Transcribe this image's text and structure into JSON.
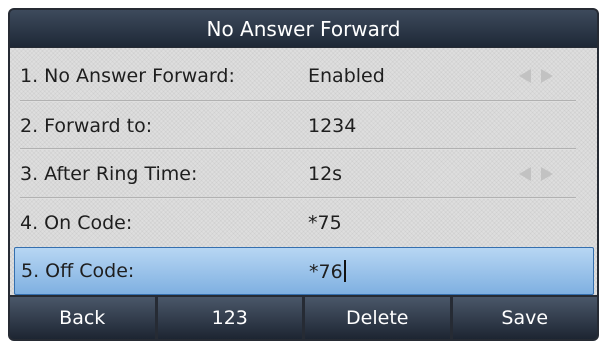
{
  "screen": {
    "title": "No Answer Forward"
  },
  "rows": [
    {
      "label": "1. No Answer Forward:",
      "value": "Enabled",
      "has_arrows": true
    },
    {
      "label": "2. Forward to:",
      "value": "1234",
      "has_arrows": false
    },
    {
      "label": "3. After Ring Time:",
      "value": "12s",
      "has_arrows": true
    },
    {
      "label": "4. On Code:",
      "value": "*75",
      "has_arrows": false
    },
    {
      "label": "5. Off Code:",
      "value": "*76",
      "has_arrows": false,
      "selected": true
    }
  ],
  "softkeys": [
    "Back",
    "123",
    "Delete",
    "Save"
  ],
  "colors": {
    "title_bar": "#2a3444",
    "selection": "#9cc3ea",
    "list_background": "#dedede",
    "softkey": "#323d4d"
  },
  "icons": {
    "option_switch": [
      "arrow-left-icon",
      "arrow-right-icon"
    ]
  }
}
